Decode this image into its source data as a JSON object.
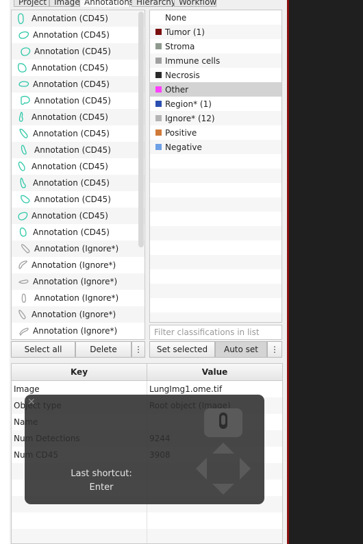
{
  "tabs": [
    "Project",
    "Image",
    "Annotations",
    "Hierarchy",
    "Workflow"
  ],
  "annotations": [
    {
      "label": "Annotation (CD45)",
      "color": "#2ec8a8"
    },
    {
      "label": "Annotation (CD45)",
      "color": "#2ec8a8"
    },
    {
      "label": "Annotation (CD45)",
      "color": "#2ec8a8"
    },
    {
      "label": "Annotation (CD45)",
      "color": "#2ec8a8"
    },
    {
      "label": "Annotation (CD45)",
      "color": "#2ec8a8"
    },
    {
      "label": "Annotation (CD45)",
      "color": "#2ec8a8"
    },
    {
      "label": "Annotation (CD45)",
      "color": "#2ec8a8"
    },
    {
      "label": "Annotation (CD45)",
      "color": "#2ec8a8"
    },
    {
      "label": "Annotation (CD45)",
      "color": "#2ec8a8"
    },
    {
      "label": "Annotation (CD45)",
      "color": "#2ec8a8"
    },
    {
      "label": "Annotation (CD45)",
      "color": "#2ec8a8"
    },
    {
      "label": "Annotation (CD45)",
      "color": "#2ec8a8"
    },
    {
      "label": "Annotation (CD45)",
      "color": "#2ec8a8"
    },
    {
      "label": "Annotation (CD45)",
      "color": "#2ec8a8"
    },
    {
      "label": "Annotation (Ignore*)",
      "color": "#a0a0a0"
    },
    {
      "label": "Annotation (Ignore*)",
      "color": "#a0a0a0"
    },
    {
      "label": "Annotation (Ignore*)",
      "color": "#a0a0a0"
    },
    {
      "label": "Annotation (Ignore*)",
      "color": "#a0a0a0"
    },
    {
      "label": "Annotation (Ignore*)",
      "color": "#a0a0a0"
    },
    {
      "label": "Annotation (Ignore*)",
      "color": "#a0a0a0"
    }
  ],
  "classes": [
    {
      "label": "None",
      "color": ""
    },
    {
      "label": "Tumor (1)",
      "color": "#7a0f0f"
    },
    {
      "label": "Stroma",
      "color": "#8f9a8f"
    },
    {
      "label": "Immune cells",
      "color": "#a0a0a0"
    },
    {
      "label": "Necrosis",
      "color": "#2a2a2a"
    },
    {
      "label": "Other",
      "color": "#ff40ff",
      "selected": true
    },
    {
      "label": "Region* (1)",
      "color": "#2a4fb0"
    },
    {
      "label": "Ignore* (12)",
      "color": "#b4b4b4"
    },
    {
      "label": "Positive",
      "color": "#d07a3a"
    },
    {
      "label": "Negative",
      "color": "#6ea0e6"
    }
  ],
  "filter_placeholder": "Filter classifications in list",
  "buttons": {
    "select_all": "Select all",
    "delete": "Delete",
    "more": "⋮",
    "set_selected": "Set selected",
    "auto_set": "Auto set"
  },
  "table": {
    "headers": {
      "key": "Key",
      "value": "Value"
    },
    "rows": [
      {
        "key": "Image",
        "value": "LungImg1.ome.tif"
      },
      {
        "key": "Object type",
        "value": "Root object (Image)"
      },
      {
        "key": "Name",
        "value": ""
      },
      {
        "key": "Num Detections",
        "value": "9244"
      },
      {
        "key": "Num CD45",
        "value": "3908"
      },
      {
        "key": "",
        "value": ""
      },
      {
        "key": "",
        "value": ""
      },
      {
        "key": "",
        "value": ""
      },
      {
        "key": "",
        "value": ""
      },
      {
        "key": "",
        "value": ""
      }
    ]
  },
  "overlay": {
    "line1": "Last shortcut:",
    "line2": "Enter",
    "close": "✕"
  }
}
